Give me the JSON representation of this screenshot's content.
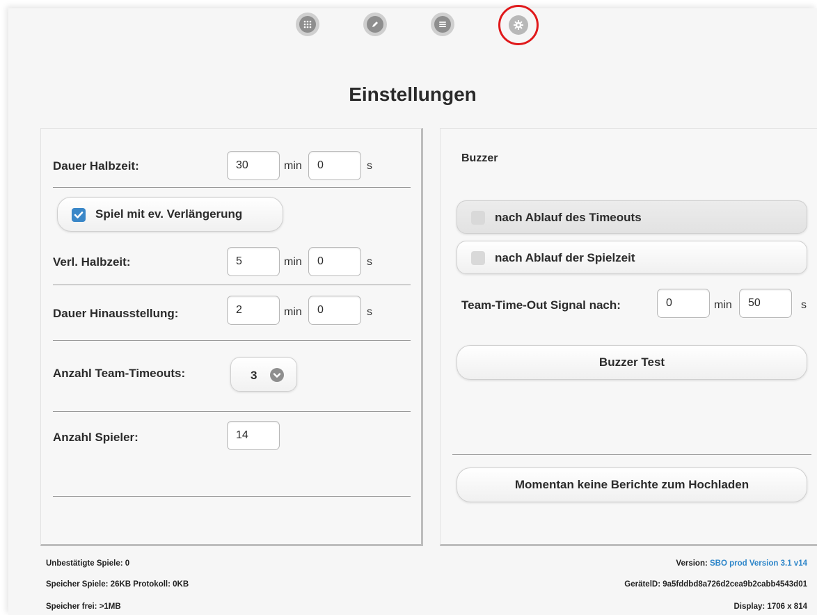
{
  "nav": {
    "items": [
      {
        "name": "grid-icon"
      },
      {
        "name": "pencil-icon"
      },
      {
        "name": "list-icon"
      },
      {
        "name": "gear-icon",
        "active": true
      }
    ]
  },
  "page_title": "Einstellungen",
  "left": {
    "halftime": {
      "label": "Dauer Halbzeit:",
      "minutes": "30",
      "seconds": "0"
    },
    "overtime_checkbox": {
      "label": "Spiel mit ev. Verlängerung",
      "checked": true
    },
    "overtime_half": {
      "label": "Verl. Halbzeit:",
      "minutes": "5",
      "seconds": "0"
    },
    "suspension": {
      "label": "Dauer Hinausstellung:",
      "minutes": "2",
      "seconds": "0"
    },
    "team_timeouts": {
      "label": "Anzahl Team-Timeouts:",
      "value": "3"
    },
    "players": {
      "label": "Anzahl Spieler:",
      "value": "14"
    },
    "unit_min": "min",
    "unit_s": "s"
  },
  "right": {
    "section_title": "Buzzer",
    "after_timeout": {
      "label": "nach Ablauf des Timeouts",
      "checked": false
    },
    "after_gametime": {
      "label": "nach Ablauf der Spielzeit",
      "checked": false
    },
    "signal": {
      "label": "Team-Time-Out Signal nach:",
      "minutes": "0",
      "seconds": "50"
    },
    "buzzer_test": "Buzzer Test",
    "upload": "Momentan keine Berichte zum Hochladen"
  },
  "footer": {
    "unconfirmed": "Unbestätigte Spiele: 0",
    "storage": "Speicher Spiele: 26KB Protokoll: 0KB",
    "free": "Speicher frei: >1MB",
    "version_label": "Version:",
    "version_value": "SBO prod Version 3.1 v14",
    "device": "GerätelD: 9a5fddbd8a726d2cea9b2cabb4543d01",
    "display": "Display: 1706 x 814"
  },
  "colors": {
    "accent": "#3a87c8",
    "active_ring": "#e0191b",
    "link": "#2e86c9"
  }
}
